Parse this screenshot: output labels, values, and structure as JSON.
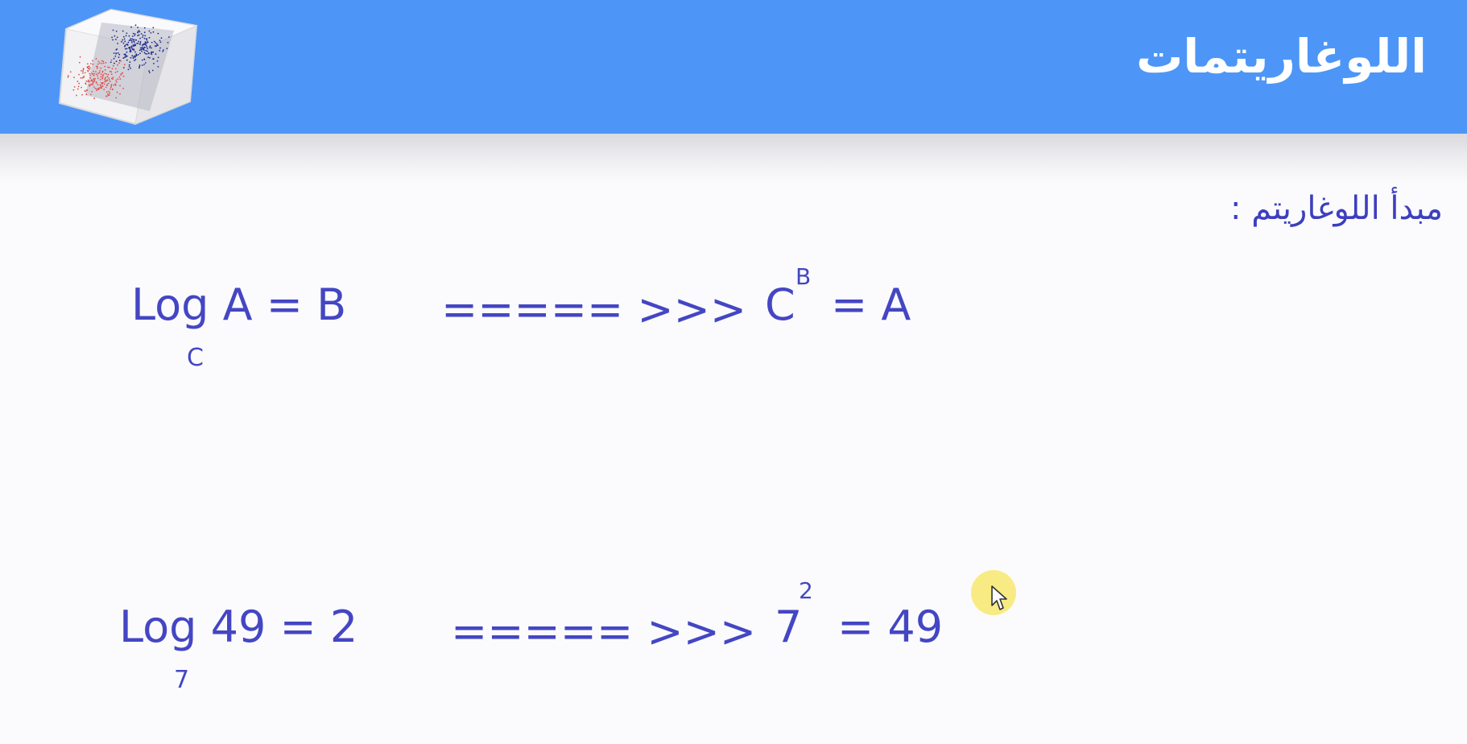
{
  "header": {
    "title": "اللوغاريتمات",
    "logo_icon": "3d-scatter-cube-icon",
    "background": "#4d96f7"
  },
  "content": {
    "subtitle": "مبدأ اللوغاريتم  :",
    "text_color": "#4446c4",
    "general_rule": {
      "lhs": "Log A  =  B",
      "base": "C",
      "arrow": "===== >>>",
      "rhs_base": "C",
      "rhs_exponent": "B",
      "rhs_rest": "= A"
    },
    "example": {
      "lhs": "Log 49  =  2",
      "base": "7",
      "arrow": "===== >>>",
      "rhs_base": "7",
      "rhs_exponent": "2",
      "rhs_rest": "= 49"
    }
  },
  "cursor": {
    "icon": "mouse-pointer-icon",
    "highlight_color": "#f7e76e"
  }
}
